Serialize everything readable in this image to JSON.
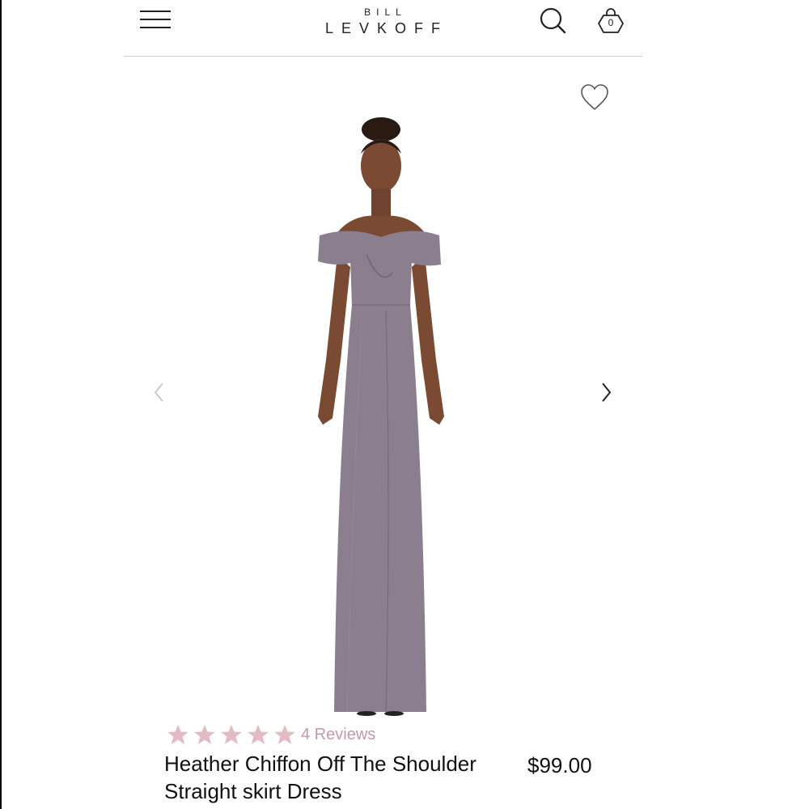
{
  "header": {
    "brand_top": "BILL",
    "brand_main": "LEVKOFF",
    "bag_count": "0",
    "icons": {
      "menu": "hamburger-menu-icon",
      "search": "search-icon",
      "bag": "shopping-bag-icon"
    }
  },
  "gallery": {
    "icons": {
      "wishlist": "heart-icon",
      "prev": "chevron-left-icon",
      "next": "chevron-right-icon"
    }
  },
  "product": {
    "rating_stars": 5,
    "reviews": "4 Reviews",
    "title": "Heather Chiffon Off The Shoulder Straight skirt Dress",
    "price": "$99.00",
    "dress_color": "#8b7f8f"
  },
  "colors": {
    "star": "#e3bcc3",
    "reviews_text": "#c59aa4",
    "divider": "#d0d0d0"
  }
}
